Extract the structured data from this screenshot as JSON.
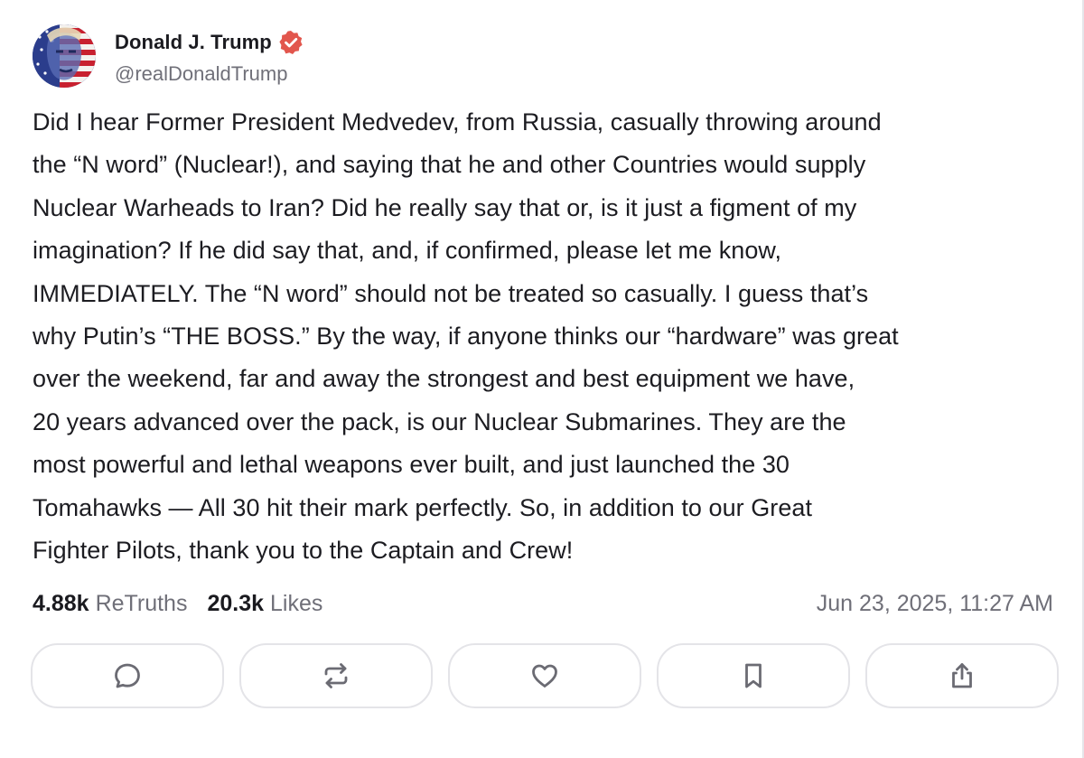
{
  "author": {
    "display_name": "Donald J. Trump",
    "handle": "@realDonaldTrump",
    "avatar_icon": "avatar-flag-portrait",
    "verified_icon": "verified-badge-icon",
    "verified_color": "#e2564d"
  },
  "post": {
    "text": "Did I hear Former President Medvedev, from Russia, casually throwing around\nthe “N word” (Nuclear!), and saying that he and other Countries would supply\nNuclear Warheads to Iran? Did he really say that or, is it just a figment of my\nimagination? If he did say that, and, if confirmed, please let me know,\nIMMEDIATELY. The “N word” should not be treated so casually. I guess that’s\nwhy Putin’s “THE BOSS.” By the way, if anyone thinks our “hardware” was great\nover the weekend, far and away the strongest and best equipment we have,\n20 years advanced over the pack, is our Nuclear Submarines. They are the\nmost powerful and lethal weapons ever built, and just launched the 30\nTomahawks — All 30 hit their mark perfectly. So, in addition to our Great\nFighter Pilots, thank you to the Captain and Crew!"
  },
  "stats": {
    "retruths_count": "4.88k",
    "retruths_label": "ReTruths",
    "likes_count": "20.3k",
    "likes_label": "Likes",
    "timestamp": "Jun 23, 2025, 11:27 AM"
  },
  "actions": [
    {
      "icon": "reply-icon"
    },
    {
      "icon": "retruth-icon"
    },
    {
      "icon": "like-heart-icon"
    },
    {
      "icon": "bookmark-icon"
    },
    {
      "icon": "share-icon"
    }
  ],
  "colors": {
    "text_primary": "#1c1c21",
    "text_secondary": "#6f6f78",
    "icon_color": "#6b6b73",
    "border": "#e4e4e8"
  }
}
